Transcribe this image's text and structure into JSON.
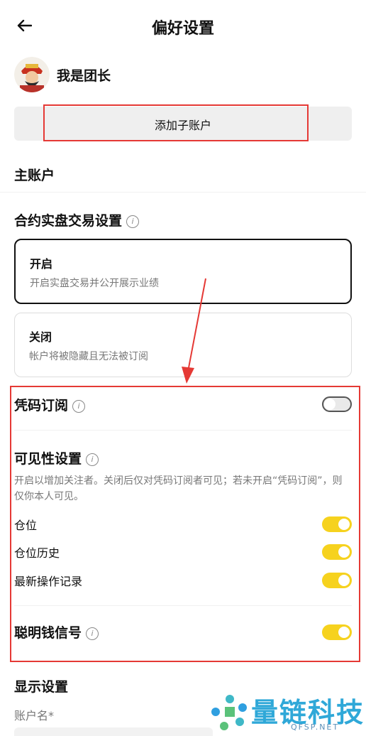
{
  "header": {
    "back_icon": "arrow-left-icon",
    "title": "偏好设置"
  },
  "profile": {
    "name": "我是团长"
  },
  "actions": {
    "add_subaccount": "添加子账户"
  },
  "main_account": {
    "label": "主账户"
  },
  "contract_trading": {
    "title": "合约实盘交易设置",
    "options": [
      {
        "title": "开启",
        "desc": "开启实盘交易并公开展示业绩",
        "selected": true
      },
      {
        "title": "关闭",
        "desc": "帐户将被隐藏且无法被订阅",
        "selected": false
      }
    ]
  },
  "code_subscription": {
    "label": "凭码订阅",
    "enabled": false
  },
  "visibility": {
    "title": "可见性设置",
    "desc": "开启以增加关注者。关闭后仅对凭码订阅者可见；若未开启“凭码订阅”，则仅你本人可见。",
    "items": [
      {
        "label": "仓位",
        "enabled": true
      },
      {
        "label": "仓位历史",
        "enabled": true
      },
      {
        "label": "最新操作记录",
        "enabled": true
      }
    ]
  },
  "smart_money": {
    "label": "聪明钱信号",
    "enabled": true
  },
  "display": {
    "title": "显示设置",
    "account_name_label": "账户名*"
  },
  "watermark": {
    "brand": "量链科技",
    "site": "QFSP.NET"
  },
  "colors": {
    "accent": "#f6d21e",
    "annotation": "#e53935"
  }
}
